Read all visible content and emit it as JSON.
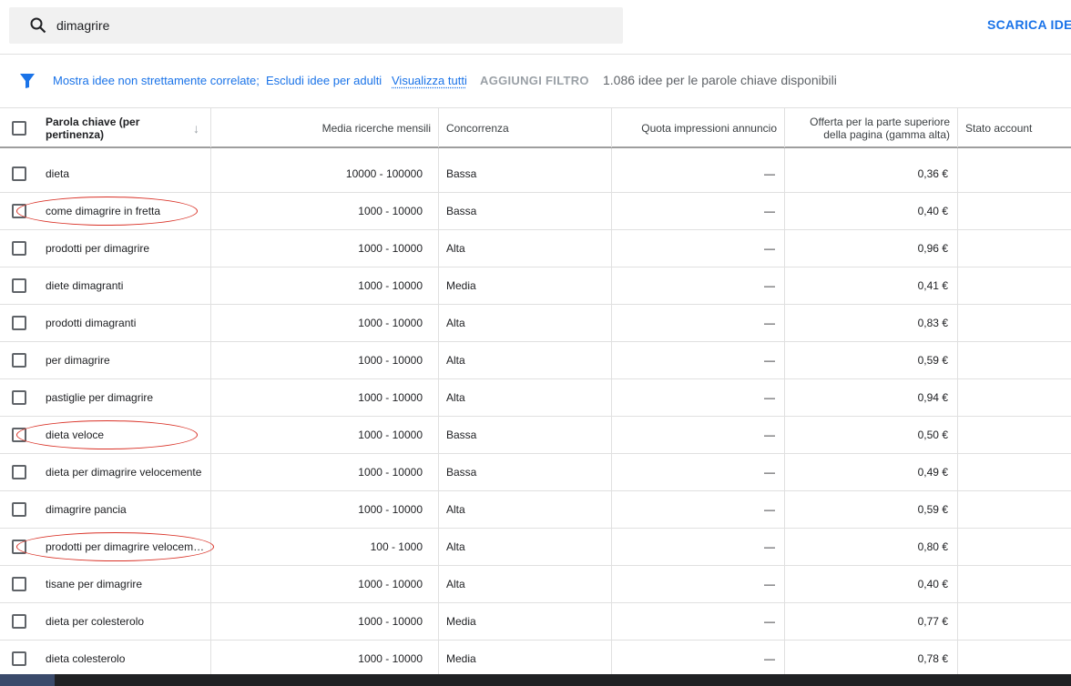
{
  "search": {
    "query": "dimagrire",
    "icon": "search-icon"
  },
  "toolbar": {
    "download_label": "SCARICA IDEE"
  },
  "filters": {
    "icon": "filter-icon",
    "chip1": "Mostra idee non strettamente correlate;",
    "chip2": "Escludi idee per adulti",
    "view_all": "Visualizza tutti",
    "add_filter": "AGGIUNGI FILTRO",
    "count_text": "1.086 idee per le parole chiave disponibili"
  },
  "table": {
    "columns": {
      "keyword": "Parola chiave (per pertinenza)",
      "volume": "Media ricerche mensili",
      "competition": "Concorrenza",
      "impression_share": "Quota impressioni annuncio",
      "top_bid": "Offerta per la parte superiore della pagina (gamma alta)",
      "account_status": "Stato account"
    },
    "rows": [
      {
        "keyword": "dieta",
        "volume": "10000 - 100000",
        "competition": "Bassa",
        "impression_share": "—",
        "top_bid": "0,36 €",
        "account_status": "",
        "highlighted": false
      },
      {
        "keyword": "come dimagrire in fretta",
        "volume": "1000 - 10000",
        "competition": "Bassa",
        "impression_share": "—",
        "top_bid": "0,40 €",
        "account_status": "",
        "highlighted": true
      },
      {
        "keyword": "prodotti per dimagrire",
        "volume": "1000 - 10000",
        "competition": "Alta",
        "impression_share": "—",
        "top_bid": "0,96 €",
        "account_status": "",
        "highlighted": false
      },
      {
        "keyword": "diete dimagranti",
        "volume": "1000 - 10000",
        "competition": "Media",
        "impression_share": "—",
        "top_bid": "0,41 €",
        "account_status": "",
        "highlighted": false
      },
      {
        "keyword": "prodotti dimagranti",
        "volume": "1000 - 10000",
        "competition": "Alta",
        "impression_share": "—",
        "top_bid": "0,83 €",
        "account_status": "",
        "highlighted": false
      },
      {
        "keyword": "per dimagrire",
        "volume": "1000 - 10000",
        "competition": "Alta",
        "impression_share": "—",
        "top_bid": "0,59 €",
        "account_status": "",
        "highlighted": false
      },
      {
        "keyword": "pastiglie per dimagrire",
        "volume": "1000 - 10000",
        "competition": "Alta",
        "impression_share": "—",
        "top_bid": "0,94 €",
        "account_status": "",
        "highlighted": false
      },
      {
        "keyword": "dieta veloce",
        "volume": "1000 - 10000",
        "competition": "Bassa",
        "impression_share": "—",
        "top_bid": "0,50 €",
        "account_status": "",
        "highlighted": true
      },
      {
        "keyword": "dieta per dimagrire velocemente",
        "volume": "1000 - 10000",
        "competition": "Bassa",
        "impression_share": "—",
        "top_bid": "0,49 €",
        "account_status": "",
        "highlighted": false
      },
      {
        "keyword": "dimagrire pancia",
        "volume": "1000 - 10000",
        "competition": "Alta",
        "impression_share": "—",
        "top_bid": "0,59 €",
        "account_status": "",
        "highlighted": false
      },
      {
        "keyword": "prodotti per dimagrire velocem…",
        "volume": "100 - 1000",
        "competition": "Alta",
        "impression_share": "—",
        "top_bid": "0,80 €",
        "account_status": "",
        "highlighted": true
      },
      {
        "keyword": "tisane per dimagrire",
        "volume": "1000 - 10000",
        "competition": "Alta",
        "impression_share": "—",
        "top_bid": "0,40 €",
        "account_status": "",
        "highlighted": false
      },
      {
        "keyword": "dieta per colesterolo",
        "volume": "1000 - 10000",
        "competition": "Media",
        "impression_share": "—",
        "top_bid": "0,77 €",
        "account_status": "",
        "highlighted": false
      },
      {
        "keyword": "dieta colesterolo",
        "volume": "1000 - 10000",
        "competition": "Media",
        "impression_share": "—",
        "top_bid": "0,78 €",
        "account_status": "",
        "highlighted": false
      }
    ]
  },
  "colors": {
    "accent": "#1a73e8",
    "highlight": "#d93025"
  }
}
